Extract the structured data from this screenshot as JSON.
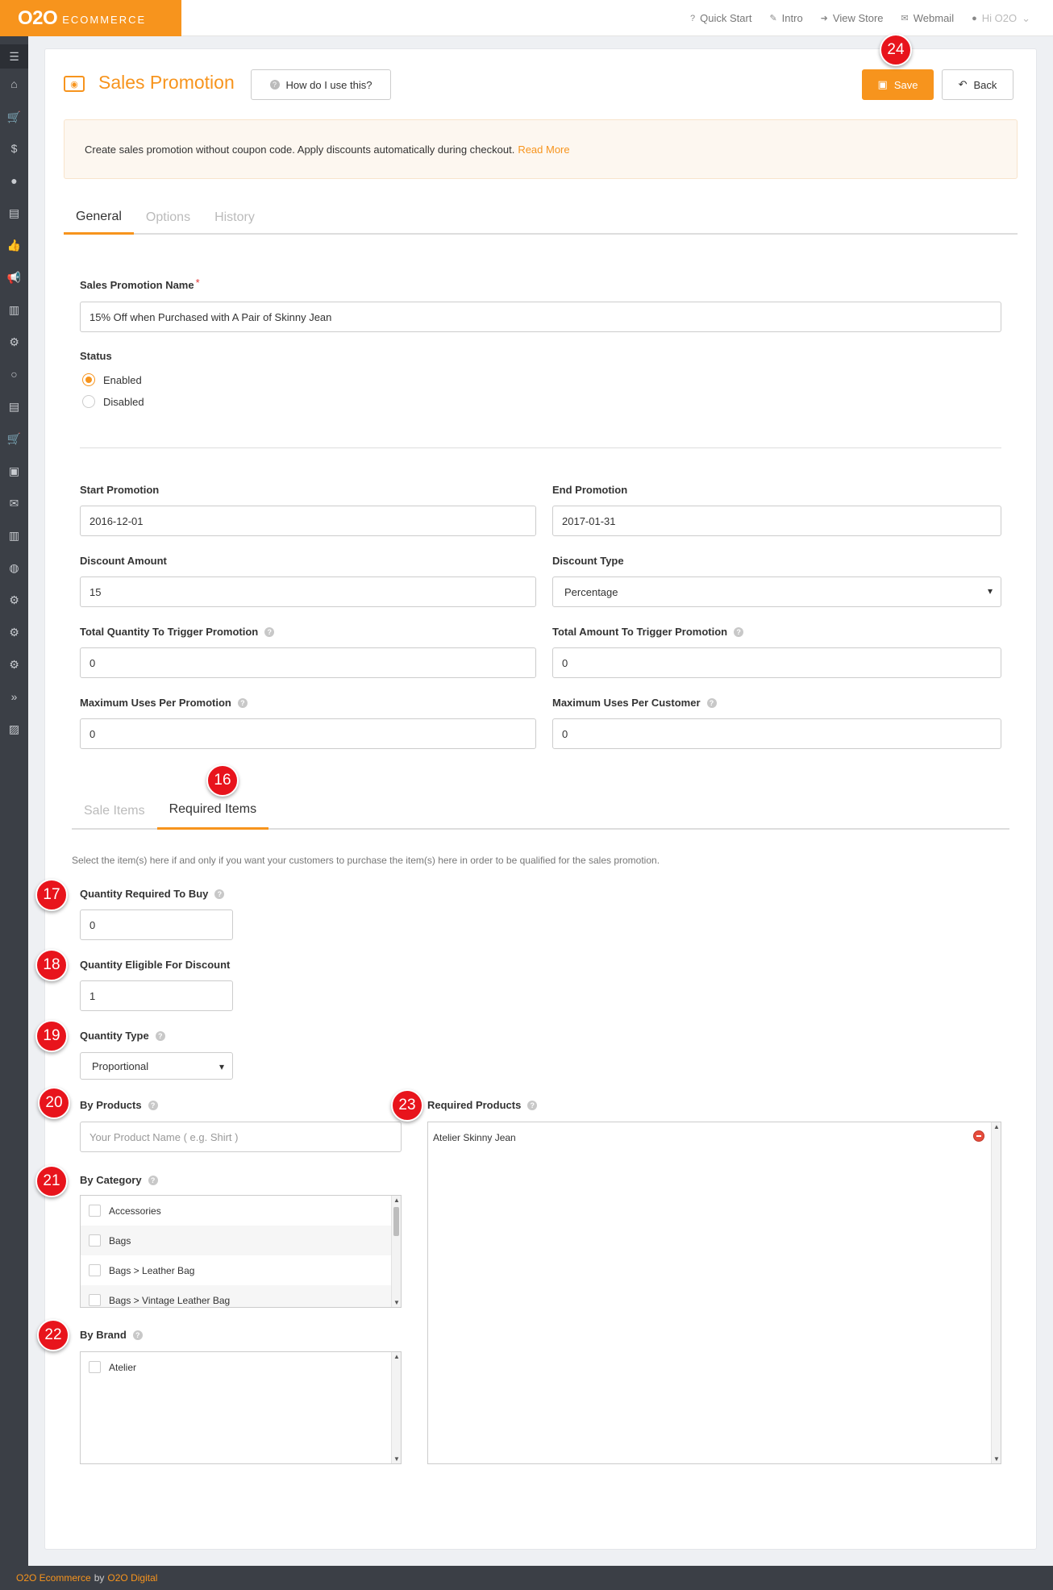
{
  "header": {
    "logo_mark": "O2O",
    "logo_word": "ECOMMERCE",
    "nav": [
      {
        "icon": "?",
        "label": "Quick Start"
      },
      {
        "icon": "✎",
        "label": "Intro"
      },
      {
        "icon": "➜",
        "label": "View Store"
      },
      {
        "icon": "✉",
        "label": "Webmail"
      }
    ],
    "user": "Hi O2O"
  },
  "sidebar": {
    "icons": [
      "☰",
      "⌂",
      "🛒",
      "$",
      "●",
      "▤",
      "👍",
      "📢",
      "▥",
      "⚙",
      "○",
      "▤",
      "🛒",
      "▣",
      "✉",
      "▥",
      "◍",
      "⚙",
      "⚙",
      "⚙",
      "»",
      "▨"
    ]
  },
  "page": {
    "title": "Sales Promotion",
    "help_button": "How do I use this?",
    "save_button": "Save",
    "back_button": "Back",
    "notice_text": "Create sales promotion without coupon code. Apply discounts automatically during checkout.",
    "notice_link": "Read More"
  },
  "tabs": [
    "General",
    "Options",
    "History"
  ],
  "form": {
    "name_label": "Sales Promotion Name",
    "name_required": "*",
    "name_value": "15% Off when Purchased with A Pair of Skinny Jean",
    "status_label": "Status",
    "status_options": [
      "Enabled",
      "Disabled"
    ],
    "status_selected": "Enabled",
    "start_label": "Start Promotion",
    "start_value": "2016-12-01",
    "end_label": "End Promotion",
    "end_value": "2017-01-31",
    "discount_amount_label": "Discount Amount",
    "discount_amount_value": "15",
    "discount_type_label": "Discount Type",
    "discount_type_value": "Percentage",
    "total_qty_label": "Total Quantity To Trigger Promotion",
    "total_qty_value": "0",
    "total_amount_label": "Total Amount To Trigger Promotion",
    "total_amount_value": "0",
    "max_uses_label": "Maximum Uses Per Promotion",
    "max_uses_value": "0",
    "max_customer_label": "Maximum Uses Per Customer",
    "max_customer_value": "0"
  },
  "subtabs": [
    "Sale Items",
    "Required Items"
  ],
  "required": {
    "hint": "Select the item(s) here if and only if you want your customers to purchase the item(s) here in order to be qualified for the sales promotion.",
    "qty_required_label": "Quantity Required To Buy",
    "qty_required_value": "0",
    "qty_eligible_label": "Quantity Eligible For Discount",
    "qty_eligible_value": "1",
    "qty_type_label": "Quantity Type",
    "qty_type_value": "Proportional",
    "by_products_label": "By Products",
    "by_products_placeholder": "Your Product Name ( e.g. Shirt )",
    "by_category_label": "By Category",
    "categories": [
      "Accessories",
      "Bags",
      "Bags > Leather Bag",
      "Bags > Vintage Leather Bag"
    ],
    "by_brand_label": "By Brand",
    "brands": [
      "Atelier"
    ],
    "required_products_label": "Required Products",
    "required_products": [
      "Atelier Skinny Jean"
    ]
  },
  "badges": [
    "24",
    "16",
    "17",
    "18",
    "19",
    "20",
    "21",
    "22",
    "23"
  ],
  "footer": {
    "brand": "O2O Ecommerce",
    "by": "by",
    "company": "O2O Digital"
  },
  "colors": {
    "accent": "#f7941d",
    "sidebar": "#3b3f46",
    "badge": "#e8141c"
  }
}
